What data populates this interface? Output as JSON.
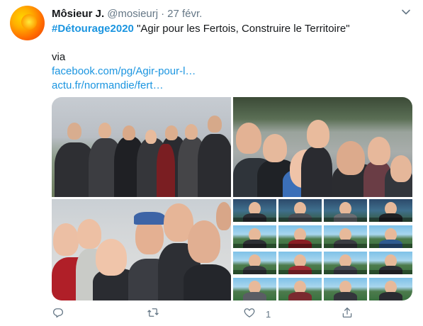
{
  "author": {
    "display_name": "Môsieur J.",
    "handle": "@mosieurj",
    "separator": "·",
    "date": "27 févr."
  },
  "tweet": {
    "hashtag": "#Détourage2020",
    "quote": " \"Agir pour les Fertois, Construire le Territoire\"",
    "via": "via",
    "link1": "facebook.com/pg/Agir-pour-l…",
    "link2": "actu.fr/normandie/fert…"
  },
  "media": {
    "photo_count": 4
  },
  "actions": {
    "reply_icon": "reply-icon",
    "retweet_icon": "retweet-icon",
    "like_icon": "heart-icon",
    "like_count": "1",
    "share_icon": "share-icon"
  },
  "colors": {
    "link": "#1b95e0",
    "muted": "#657786",
    "text": "#14171a"
  }
}
